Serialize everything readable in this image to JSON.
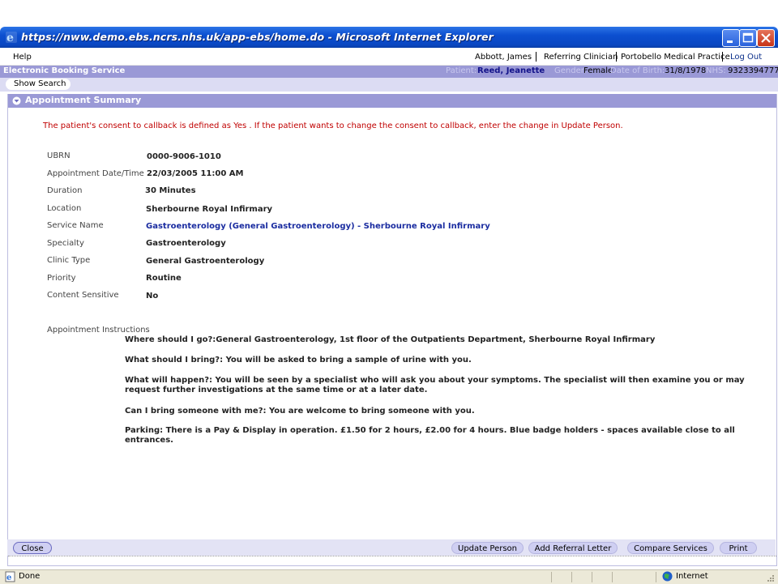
{
  "window": {
    "title": "https://nww.demo.ebs.ncrs.nhs.uk/app-ebs/home.do - Microsoft Internet Explorer"
  },
  "menubar": {
    "help": "Help",
    "user": "Abbott, James",
    "role": "Referring Clinician",
    "practice": "Portobello Medical Practice",
    "logout": "Log Out"
  },
  "appbar": {
    "title": "Electronic Booking Service",
    "patient_label": "Patient:",
    "patient_name": "Reed, Jeanette",
    "gender_label": "Gender:",
    "gender": "Female",
    "dob_label": "Date of Birth:",
    "dob": "31/8/1978",
    "nhs_label": "NHS:",
    "nhs": "9323394777"
  },
  "search": {
    "show_search": "Show Search"
  },
  "section": {
    "title": "Appointment Summary",
    "consent_message": "The patient's consent to callback is defined as Yes . If the patient wants to change the consent to callback, enter the change in Update Person."
  },
  "fields": [
    {
      "label": "UBRN",
      "value": "0000-9006-1010"
    },
    {
      "label": "Appointment Date/Time",
      "value": "22/03/2005 11:00 AM"
    },
    {
      "label": "Duration",
      "value": "30 Minutes"
    },
    {
      "label": "Location",
      "value": "Sherbourne Royal Infirmary"
    },
    {
      "label": "Service Name",
      "value": "Gastroenterology (General Gastroenterology) - Sherbourne Royal Infirmary"
    },
    {
      "label": "Specialty",
      "value": "Gastroenterology"
    },
    {
      "label": "Clinic Type",
      "value": "General Gastroenterology"
    },
    {
      "label": "Priority",
      "value": "Routine"
    },
    {
      "label": "Content Sensitive",
      "value": "No"
    }
  ],
  "instructions": {
    "label": "Appointment Instructions",
    "items": [
      "Where should I go?:General Gastroenterology, 1st floor of the Outpatients Department, Sherbourne Royal Infirmary",
      "What should I bring?: You will be asked to bring a sample of urine with you.",
      "What will happen?: You will be seen by a specialist who will ask you about your symptoms. The specialist will then examine you or may request further investigations at the same time or at a later date.",
      "Can I bring someone with me?: You are welcome to bring someone with you.",
      "Parking:  There is a Pay & Display in operation.  £1.50 for 2 hours, £2.00 for 4 hours.  Blue badge holders - spaces available close to all entrances."
    ]
  },
  "footer": {
    "close": "Close",
    "update_person": "Update Person",
    "add_referral_letter": "Add Referral Letter",
    "compare_services": "Compare Services",
    "print": "Print"
  },
  "statusbar": {
    "status": "Done",
    "zone": "Internet"
  },
  "colors": {
    "titlebar": "#0a47c2",
    "appbar": "#9a99d6",
    "consent_text": "#c00000",
    "link": "#1a2ca0"
  }
}
